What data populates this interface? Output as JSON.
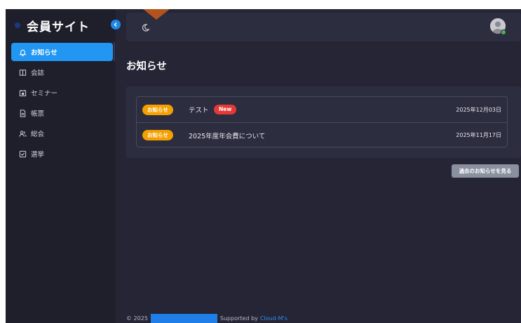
{
  "app": {
    "title": "会員サイト"
  },
  "sidebar": {
    "items": [
      {
        "label": "お知らせ",
        "icon": "bell-icon",
        "active": true
      },
      {
        "label": "会誌",
        "icon": "book-icon",
        "active": false
      },
      {
        "label": "セミナー",
        "icon": "calendar-icon",
        "active": false
      },
      {
        "label": "帳票",
        "icon": "document-icon",
        "active": false
      },
      {
        "label": "総会",
        "icon": "people-icon",
        "active": false
      },
      {
        "label": "選挙",
        "icon": "checkbox-icon",
        "active": false
      }
    ]
  },
  "header": {
    "theme_icon": "moon-icon",
    "avatar_icon": "user-avatar-icon"
  },
  "main": {
    "title": "お知らせ",
    "notices": [
      {
        "tag": "お知らせ",
        "title": "テスト",
        "badge": "New",
        "date": "2025年12月03日"
      },
      {
        "tag": "お知らせ",
        "title": "2025年度年会費について",
        "badge": "",
        "date": "2025年11月17日"
      }
    ],
    "past_button": "過去のお知らせを見る"
  },
  "footer": {
    "copyright": "© 2025",
    "supported_by": "Supported by",
    "provider": "Cloud-M's"
  },
  "colors": {
    "background": "#252535",
    "sidebar": "#1f1f2c",
    "panel": "#2d2d40",
    "accent": "#2196f3",
    "tag": "#f5a000",
    "new_badge": "#e53935",
    "button": "#8a90a0"
  }
}
